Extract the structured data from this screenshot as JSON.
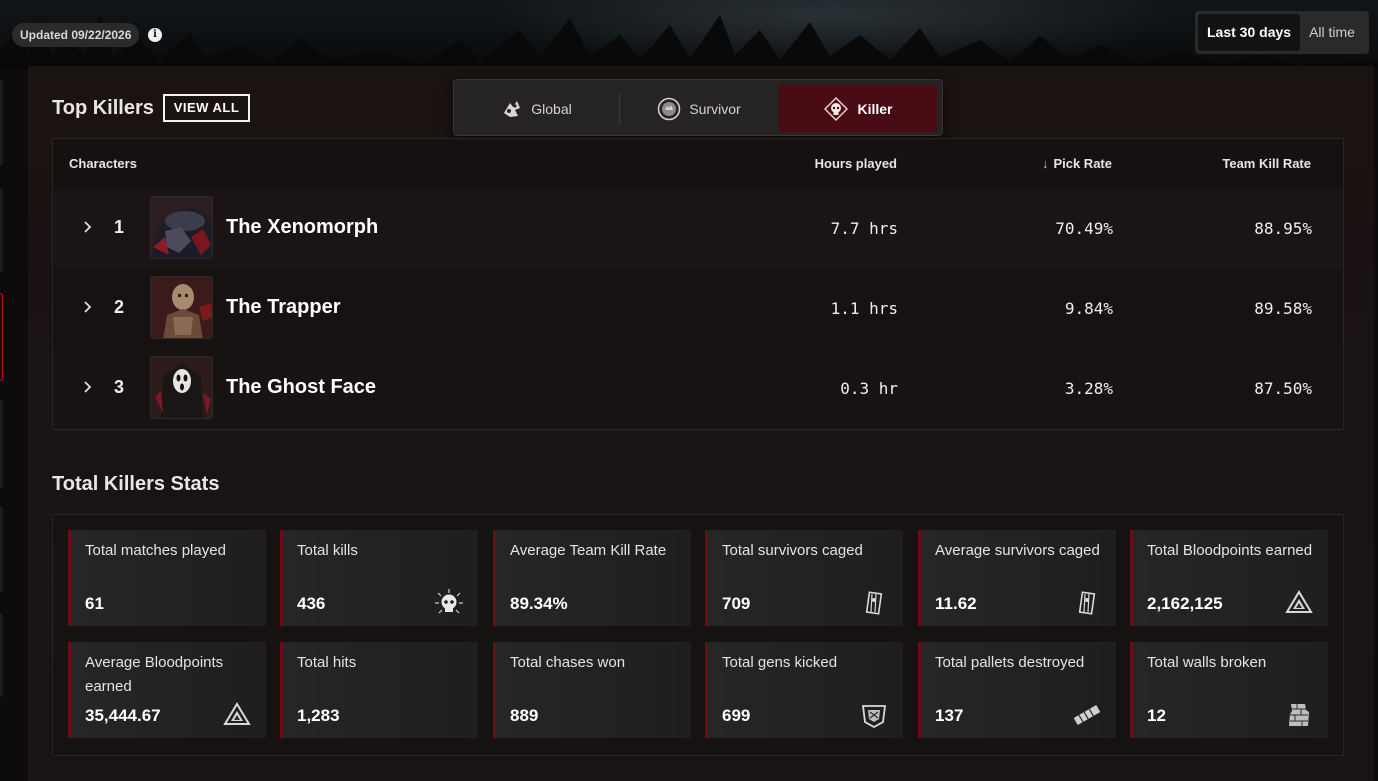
{
  "header": {
    "updated": "Updated 09/22/2026",
    "range_options": [
      "Last 30 days",
      "All time"
    ],
    "range_selected": "Last 30 days"
  },
  "top_killers": {
    "title": "Top Killers",
    "view_all": "VIEW ALL",
    "modes": [
      {
        "label": "Global",
        "icon": "global-mode-icon",
        "active": false
      },
      {
        "label": "Survivor",
        "icon": "survivor-mode-icon",
        "active": false
      },
      {
        "label": "Killer",
        "icon": "killer-skull-icon",
        "active": true
      }
    ],
    "columns": {
      "characters": "Characters",
      "hours": "Hours played",
      "pick_rate": "Pick Rate",
      "team_kill_rate": "Team Kill Rate"
    },
    "rows": [
      {
        "rank": "1",
        "name": "The Xenomorph",
        "hours": "7.7 hrs",
        "pick_rate": "70.49%",
        "team_kill_rate": "88.95%"
      },
      {
        "rank": "2",
        "name": "The Trapper",
        "hours": "1.1 hrs",
        "pick_rate": "9.84%",
        "team_kill_rate": "89.58%"
      },
      {
        "rank": "3",
        "name": "The Ghost Face",
        "hours": "0.3 hr",
        "pick_rate": "3.28%",
        "team_kill_rate": "87.50%"
      }
    ]
  },
  "stats": {
    "title": "Total Killers Stats",
    "cards": [
      {
        "label": "Total matches played",
        "value": "61",
        "icon": ""
      },
      {
        "label": "Total kills",
        "value": "436",
        "icon": "skull-icon"
      },
      {
        "label": "Average Team Kill Rate",
        "value": "89.34%",
        "icon": ""
      },
      {
        "label": "Total survivors caged",
        "value": "709",
        "icon": "cage-icon"
      },
      {
        "label": "Average survivors caged",
        "value": "11.62",
        "icon": "cage-icon"
      },
      {
        "label": "Total Bloodpoints earned",
        "value": "2,162,125",
        "icon": "bloodpoints-icon"
      },
      {
        "label": "Average Bloodpoints earned",
        "value": "35,444.67",
        "icon": "bloodpoints-icon"
      },
      {
        "label": "Total hits",
        "value": "1,283",
        "icon": ""
      },
      {
        "label": "Total chases won",
        "value": "889",
        "icon": ""
      },
      {
        "label": "Total gens kicked",
        "value": "699",
        "icon": "generator-kick-icon"
      },
      {
        "label": "Total pallets destroyed",
        "value": "137",
        "icon": "pallet-icon"
      },
      {
        "label": "Total walls broken",
        "value": "12",
        "icon": "breakable-wall-icon"
      }
    ]
  },
  "colors": {
    "accent": "#6b0d12",
    "active_tab": "#4a0c14",
    "background": "#1a1313"
  }
}
